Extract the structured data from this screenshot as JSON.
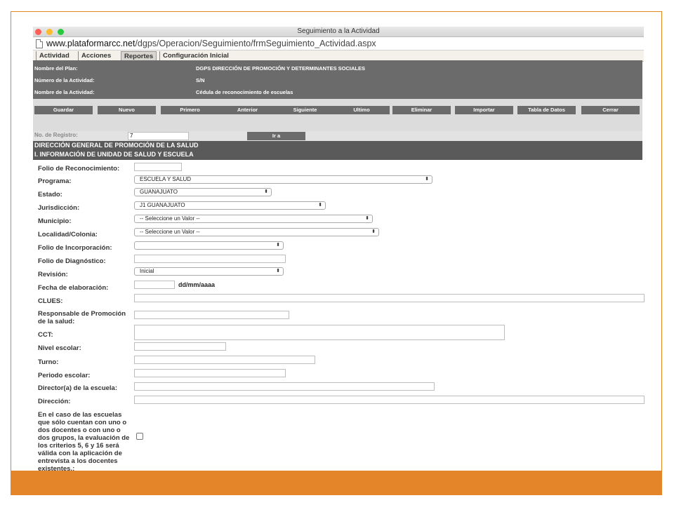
{
  "browser": {
    "window_title": "Seguimiento a la Actividad",
    "url_domain": "www.plataformarcc.net",
    "url_path": "/dgps/Operacion/Seguimiento/frmSeguimiento_Actividad.aspx"
  },
  "menu": [
    "Actividad",
    "Acciones",
    "Reportes",
    "Configuración Inicial"
  ],
  "header": {
    "plan_label": "Nombre del Plan:",
    "plan_value": "DGPS DIRECCIÓN DE PROMOCIÓN Y DETERMINANTES SOCIALES",
    "num_label": "Número de la Actividad:",
    "num_value": "S/N",
    "name_label": "Nombre de la Actividad:",
    "name_value": "Cédula de reconocimiento de escuelas"
  },
  "buttons": [
    "Guardar",
    "Nuevo",
    "Primero",
    "Anterior",
    "Siguiente",
    "Ultimo",
    "Eliminar",
    "Importar",
    "Tabla de Datos",
    "Cerrar"
  ],
  "registro": {
    "label": "No. de Registro:",
    "value": "7",
    "go_button": "Ir a"
  },
  "section": {
    "line1": "DIRECCIÓN GENERAL DE PROMOCIÓN DE LA SALUD",
    "line2": "I. INFORMACIÓN DE UNIDAD DE SALUD Y ESCUELA"
  },
  "fields": {
    "folio_reconocimiento": "Folio de Reconocimiento:",
    "programa": "Programa:",
    "programa_value": "ESCUELA Y SALUD",
    "estado": "Estado:",
    "estado_value": "GUANAJUATO",
    "jurisdiccion": "Jurisdicción:",
    "jurisdiccion_value": "J1 GUANAJUATO",
    "municipio": "Municipio:",
    "municipio_value": "-- Seleccione un Valor --",
    "localidad": "Localidad/Colonia:",
    "localidad_value": "-- Seleccione un Valor --",
    "folio_incorporacion": "Folio de Incorporación:",
    "folio_diagnostico": "Folio de Diagnóstico:",
    "revision": "Revisión:",
    "revision_value": "Inicial",
    "fecha": "Fecha de elaboración:",
    "fecha_hint": "dd/mm/aaaa",
    "clues": "CLUES:",
    "responsable": "Responsable de Promoción de la salud:",
    "cct": "CCT:",
    "nivel": "Nivel escolar:",
    "turno": "Turno:",
    "periodo": "Periodo escolar:",
    "director": "Director(a) de la escuela:",
    "direccion": "Dirección:",
    "criterio": "En el caso de las escuelas que sólo cuentan con uno o dos docentes o con uno o dos grupos, la evaluación de los criterios 5, 6 y 16 será válida con la aplicación de entrevista a los docentes existentes.:"
  },
  "colors": {
    "accent_orange": "#e4852a",
    "header_gray": "#6b6b6b"
  }
}
